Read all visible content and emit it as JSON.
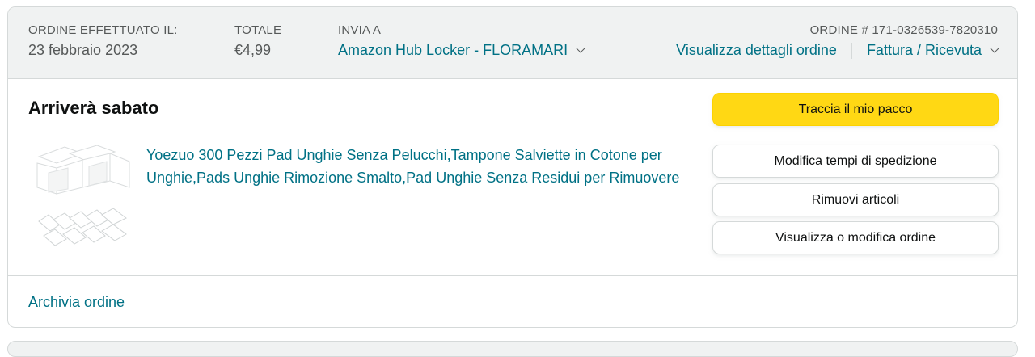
{
  "order_header": {
    "placed_label": "ORDINE EFFETTUATO IL:",
    "placed_date": "23 febbraio 2023",
    "total_label": "TOTALE",
    "total_value": "€4,99",
    "ship_to_label": "INVIA A",
    "ship_to_value": "Amazon Hub Locker - FLORAMARI",
    "order_number": "ORDINE # 171-0326539-7820310",
    "details_link": "Visualizza dettagli ordine",
    "invoice_link": "Fattura / Ricevuta"
  },
  "shipment": {
    "status": "Arriverà sabato"
  },
  "product": {
    "title": "Yoezuo 300 Pezzi Pad Unghie Senza Pelucchi,Tampone Salviette in Cotone per Unghie,Pads Unghie Rimozione Smalto,Pad Unghie Senza Residui per Rimuovere",
    "image_icon": "cotton-pads-product-image"
  },
  "actions": {
    "track": "Traccia il mio pacco",
    "change_delivery": "Modifica tempi di spedizione",
    "remove_items": "Rimuovi articoli",
    "view_edit": "Visualizza o modifica ordine"
  },
  "footer": {
    "archive": "Archivia ordine"
  },
  "colors": {
    "link": "#007185",
    "primary_button": "#FFD814",
    "header_bg": "#F0F2F2",
    "border": "#D5D9D9"
  }
}
